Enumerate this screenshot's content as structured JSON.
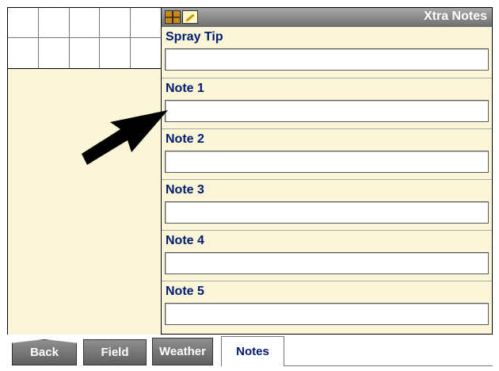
{
  "window": {
    "title": "Xtra Notes"
  },
  "title_icons": [
    "grid-icon",
    "note-edit-icon"
  ],
  "fields": [
    {
      "label": "Spray Tip",
      "value": ""
    },
    {
      "label": "Note 1",
      "value": ""
    },
    {
      "label": "Note 2",
      "value": ""
    },
    {
      "label": "Note 3",
      "value": ""
    },
    {
      "label": "Note 4",
      "value": ""
    },
    {
      "label": "Note 5",
      "value": ""
    }
  ],
  "tabs": {
    "back": "Back",
    "field": "Field",
    "weather": "Weather",
    "notes": "Notes",
    "active": "Notes"
  },
  "colors": {
    "panel_bg": "#fbf6d8",
    "label_text": "#001a70",
    "titlebar": "#8a8a8a",
    "tab_bg": "#707070"
  }
}
